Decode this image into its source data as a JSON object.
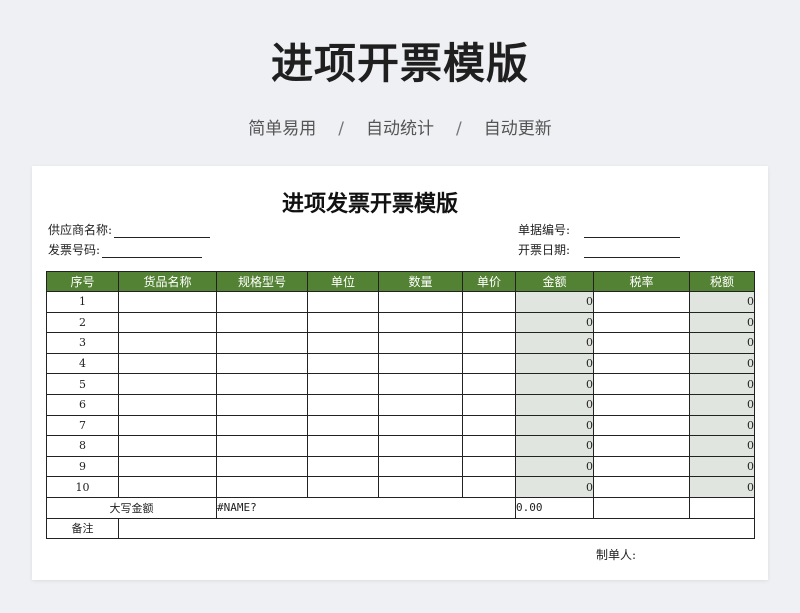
{
  "banner": {
    "title": "进项开票模版",
    "features": [
      "简单易用",
      "自动统计",
      "自动更新"
    ],
    "separator": "/"
  },
  "sheet": {
    "title": "进项发票开票模版",
    "fields": {
      "supplier_label": "供应商名称:",
      "invoice_no_label": "发票号码:",
      "doc_no_label": "单据编号:",
      "date_label": "开票日期:"
    },
    "table": {
      "headers": [
        "序号",
        "货品名称",
        "规格型号",
        "单位",
        "数量",
        "单价",
        "金额",
        "税率",
        "税额"
      ],
      "rows": [
        {
          "no": "1",
          "amount": "0",
          "tax": "0"
        },
        {
          "no": "2",
          "amount": "0",
          "tax": "0"
        },
        {
          "no": "3",
          "amount": "0",
          "tax": "0"
        },
        {
          "no": "4",
          "amount": "0",
          "tax": "0"
        },
        {
          "no": "5",
          "amount": "0",
          "tax": "0"
        },
        {
          "no": "6",
          "amount": "0",
          "tax": "0"
        },
        {
          "no": "7",
          "amount": "0",
          "tax": "0"
        },
        {
          "no": "8",
          "amount": "0",
          "tax": "0"
        },
        {
          "no": "9",
          "amount": "0",
          "tax": "0"
        },
        {
          "no": "10",
          "amount": "0",
          "tax": "0"
        }
      ],
      "capital_label": "大写金额",
      "capital_value": "#NAME?",
      "total_value": "0.00",
      "remark_label": "备注"
    },
    "maker_label": "制单人:"
  },
  "colors": {
    "header_green": "#548235",
    "shaded_cell": "#e1e5e0",
    "page_bg": "#eef0f3"
  }
}
